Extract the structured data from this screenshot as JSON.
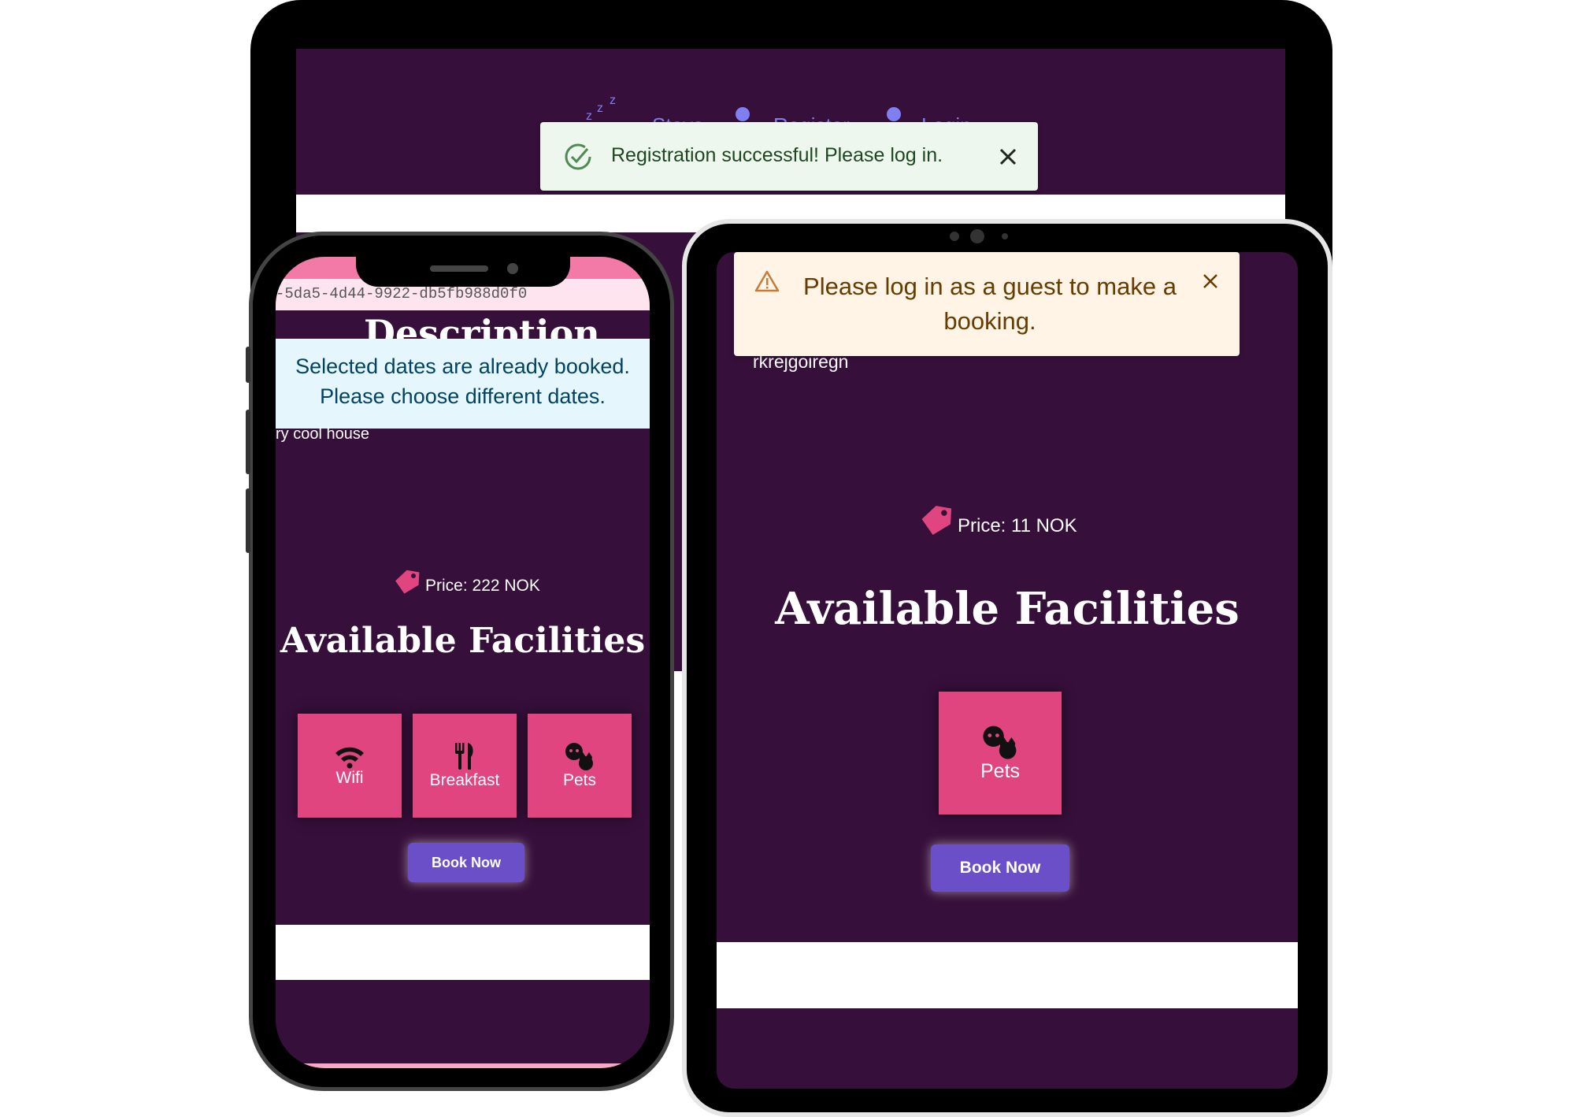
{
  "laptop": {
    "nav": {
      "stays": "Stays",
      "register": "Register",
      "login": "Login"
    },
    "toast_success": {
      "message": "Registration successful! Please log in."
    }
  },
  "phone": {
    "url_fragment": "-5da5-4d44-9922-db5fb988d0f0",
    "description_heading": "Description",
    "info_toast": {
      "line1": "Selected dates are already booked.",
      "line2": "Please choose different dates."
    },
    "description_text": "ry cool house",
    "price": "Price: 222 NOK",
    "facilities_heading": "Available Facilities",
    "facilities": [
      {
        "label": "Wifi",
        "icon": "wifi-icon"
      },
      {
        "label": "Breakfast",
        "icon": "utensils-icon"
      },
      {
        "label": "Pets",
        "icon": "pets-icon"
      }
    ],
    "book_now": "Book Now"
  },
  "tablet": {
    "warning_toast": {
      "message": "Please log in as a guest to make a booking."
    },
    "description_text": "rkrejgoiregn",
    "price": "Price: 11 NOK",
    "facilities_heading": "Available Facilities",
    "facilities": [
      {
        "label": "Pets",
        "icon": "pets-icon"
      }
    ],
    "book_now": "Book Now"
  },
  "colors": {
    "background_purple": "#360f3a",
    "tile_pink": "#e0457f",
    "button_purple": "#6a4fc8",
    "nav_lavender": "#7f7ff0",
    "success_bg": "#edf7ed",
    "warning_bg": "#fff4e5",
    "info_bg": "#e5f6fd"
  }
}
